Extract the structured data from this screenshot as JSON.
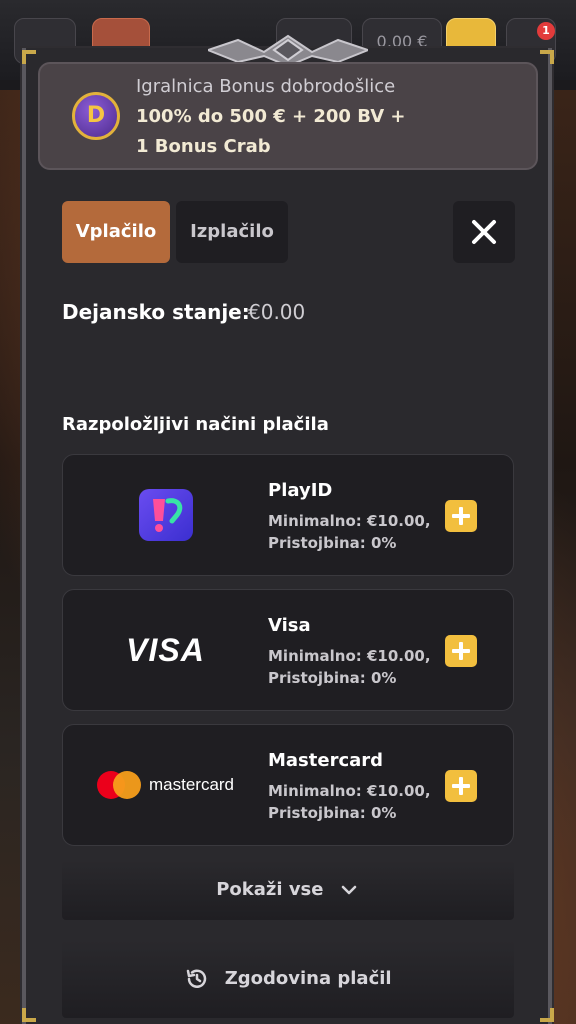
{
  "background": {
    "balance": "0,00 €",
    "notification_count": "1"
  },
  "bonus": {
    "title": "Igralnica Bonus dobrodošlice",
    "line1": "100% do 500 € + 200 BV +",
    "line2": "1 Bonus Crab",
    "logo_letter": "D"
  },
  "tabs": {
    "deposit": "Vplačilo",
    "withdraw": "Izplačilo"
  },
  "balance": {
    "label": "Dejansko stanje:",
    "value": "€0.00"
  },
  "methods_heading": "Razpoložljivi načini plačila",
  "methods": [
    {
      "name": "PlayID",
      "minimum": "Minimalno: €10.00,",
      "fee": "Pristojbina: 0%",
      "logo": "playid-logo"
    },
    {
      "name": "Visa",
      "minimum": "Minimalno: €10.00,",
      "fee": "Pristojbina: 0%",
      "logo": "VISA"
    },
    {
      "name": "Mastercard",
      "minimum": "Minimalno: €10.00,",
      "fee": "Pristojbina: 0%",
      "logo": "mastercard"
    }
  ],
  "show_all": "Pokaži vse",
  "history": "Zgodovina plačil",
  "colors": {
    "accent": "#b46a3b",
    "add_button": "#f2bf3e",
    "panel": "#2a292d",
    "card": "#1f1e22"
  }
}
